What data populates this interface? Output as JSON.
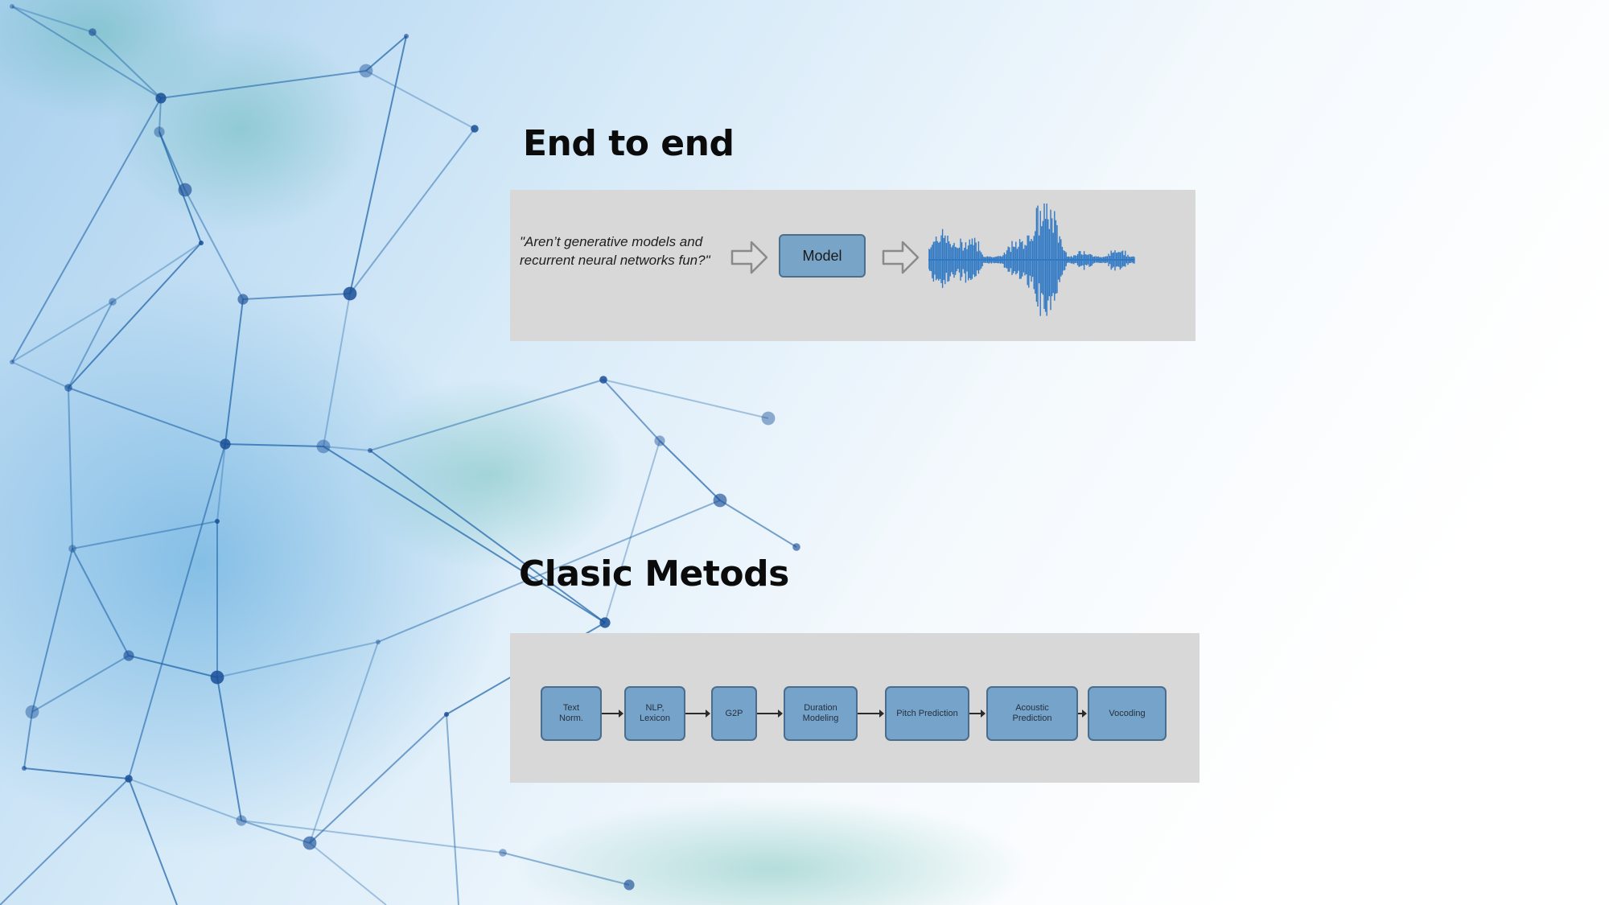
{
  "slide": {
    "end_to_end": {
      "title": "End to end",
      "input_text": "\"Aren’t generative models and recurrent neural networks fun?\"",
      "model_label": "Model"
    },
    "classic": {
      "title": "Clasic Metods",
      "stages": [
        {
          "label": "Text\nNorm."
        },
        {
          "label": "NLP,\nLexicon"
        },
        {
          "label": "G2P"
        },
        {
          "label": "Duration\nModeling"
        },
        {
          "label": "Pitch Prediction"
        },
        {
          "label": "Acoustic\nPrediction"
        },
        {
          "label": "Vocoding"
        }
      ]
    }
  },
  "colors": {
    "box_fill": "#78a4c8",
    "box_border": "#4c6f8e",
    "waveform": "#2f78c4",
    "panel": "#d8d8d8",
    "network_lines": "#1e63a8"
  }
}
